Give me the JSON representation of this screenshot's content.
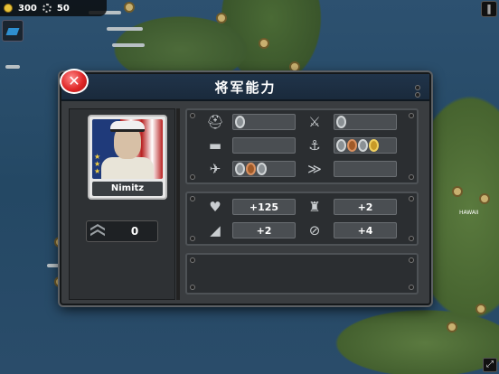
{
  "hud": {
    "gold": "300",
    "gear": "50"
  },
  "map_label": "HAWAII",
  "dialog": {
    "title": "将军能力",
    "general_name": "Nimitz",
    "rank_value": "0",
    "stats": {
      "health": "+125",
      "fortify": "+2",
      "supply": "+2",
      "morale": "+4"
    }
  },
  "colors": {
    "close": "#e02828",
    "title_bar": "#20344a",
    "panel": "#2b2e31"
  }
}
